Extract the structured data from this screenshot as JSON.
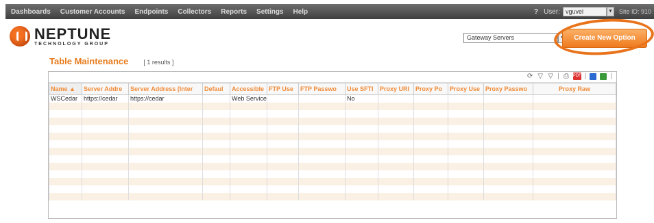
{
  "nav": {
    "items": [
      "Dashboards",
      "Customer Accounts",
      "Endpoints",
      "Collectors",
      "Reports",
      "Settings",
      "Help"
    ],
    "help_icon": "?",
    "user_label": "User:",
    "user_value": "vguvel",
    "site_label": "Site ID: 910"
  },
  "logo": {
    "brand": "NEPTUNE",
    "sub": "TECHNOLOGY GROUP"
  },
  "gateway_select": {
    "value": "Gateway Servers"
  },
  "create_button": {
    "label": "Create New Option"
  },
  "page": {
    "title": "Table Maintenance",
    "results": "[ 1 results ]"
  },
  "table": {
    "headers": [
      "Name",
      "Server Addre",
      "Server Address (Inter",
      "Defaul",
      "Accessible",
      "FTP Use",
      "FTP Passwo",
      "Use SFTI",
      "Proxy URI",
      "Proxy Po",
      "Proxy Use",
      "Proxy Passwo",
      "Proxy Raw"
    ],
    "sort_indicator": "▲",
    "rows": [
      [
        "WSCedar",
        "https://cedar",
        "https://cedar",
        "",
        "Web Service",
        "",
        "",
        "No",
        "",
        "",
        "",
        "",
        ""
      ]
    ],
    "empty_rows": 13
  },
  "colors": {
    "accent": "#e87c1e",
    "header_text": "#f08a36",
    "row_stripe": "#fbf0e4",
    "nav_bg": "#4f4f4f"
  }
}
